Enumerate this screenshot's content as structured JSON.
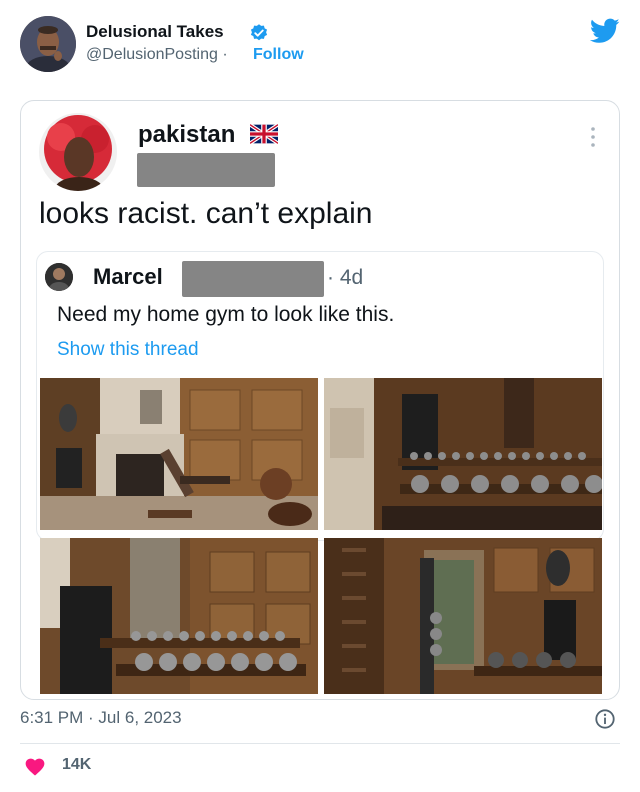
{
  "tweet": {
    "author": {
      "name": "Delusional Takes",
      "handle": "@DelusionPosting",
      "separator": "·",
      "follow_label": "Follow"
    },
    "timestamp": "6:31 PM · Jul 6, 2023",
    "likes": "14K"
  },
  "embedded_post": {
    "author_name": "pakistan",
    "text": "looks racist. can’t explain",
    "quoted": {
      "author_name": "Marcel",
      "time": "· 4d",
      "text": "Need my home gym to look like this.",
      "link": "Show this thread"
    }
  },
  "icons": {
    "verified": "verified-badge-icon",
    "brand": "twitter-bird-icon",
    "flag": "union-jack-flag-icon",
    "more": "more-dots-icon",
    "info": "info-icon",
    "like": "heart-icon"
  },
  "colors": {
    "accent": "#1d9bf0",
    "heart": "#f91880",
    "text": "#0f1419",
    "muted": "#536471"
  }
}
